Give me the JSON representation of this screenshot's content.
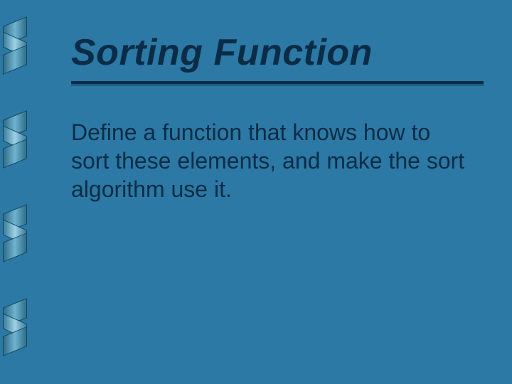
{
  "slide": {
    "title": "Sorting Function",
    "body": "Define a function that knows how to sort these elements, and make the sort algorithm use it."
  },
  "colors": {
    "background": "#2b79a4",
    "text": "#0b2c47"
  }
}
